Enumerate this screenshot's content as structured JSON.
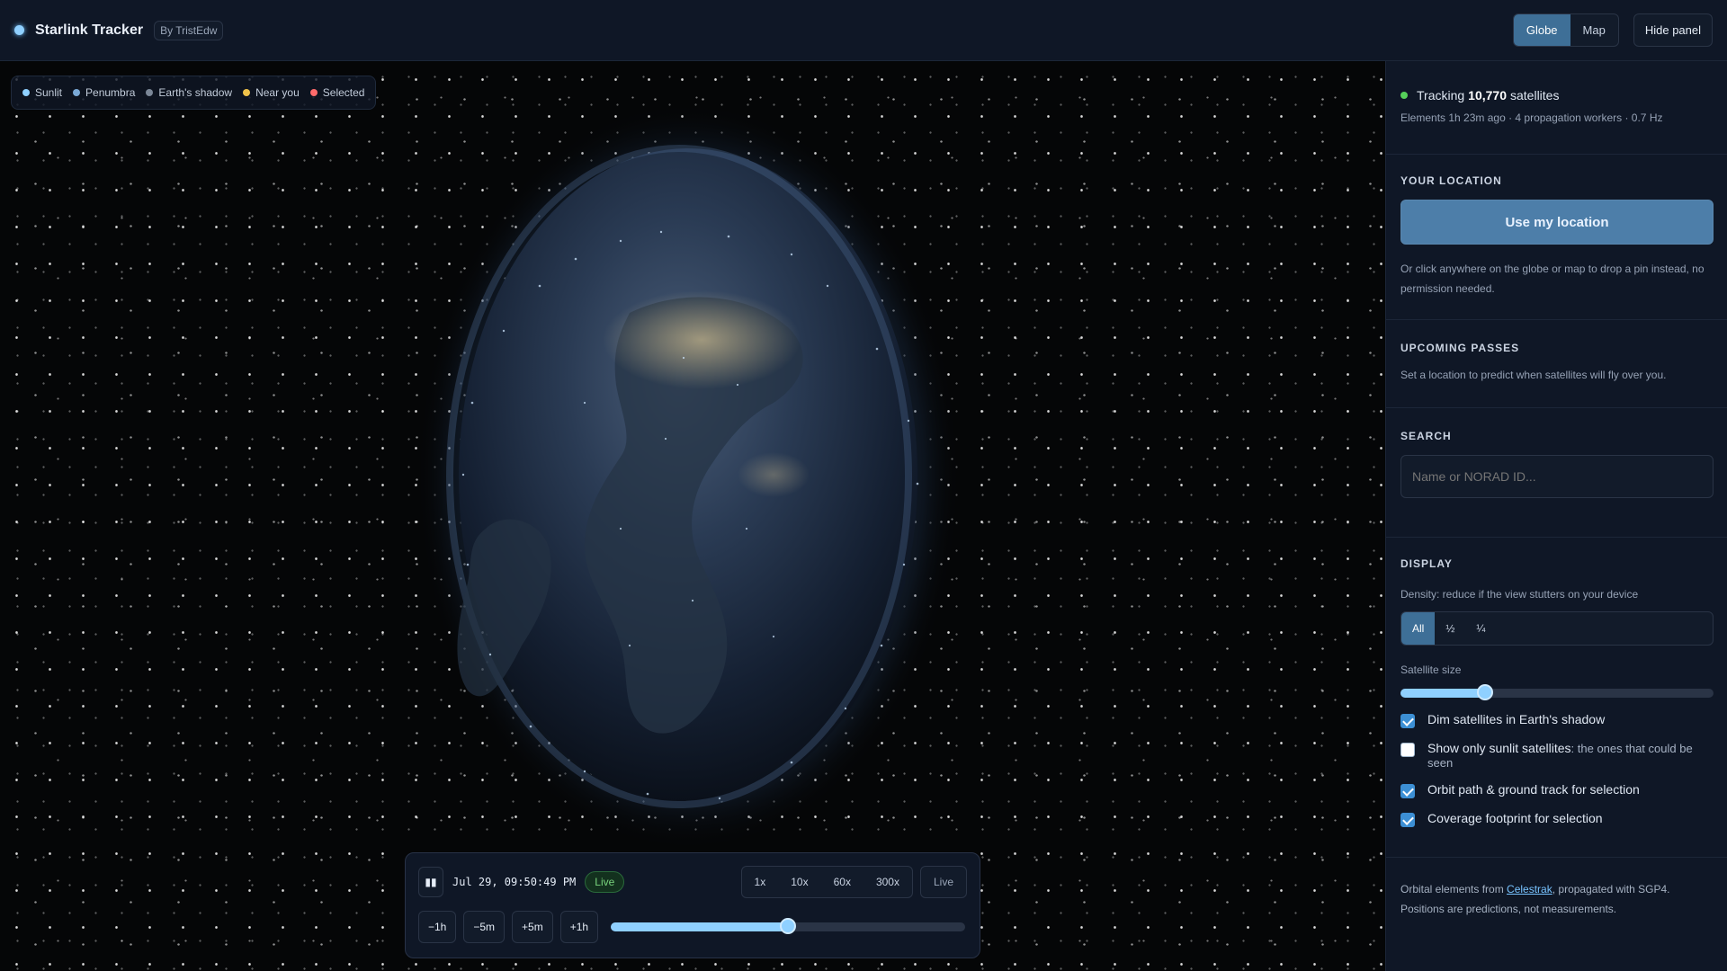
{
  "app": {
    "title": "Starlink Tracker",
    "by": "By TristEdw",
    "view_tabs": [
      {
        "label": "Globe",
        "active": true
      },
      {
        "label": "Map",
        "active": false
      }
    ],
    "hide_panel": "Hide panel"
  },
  "legend": [
    {
      "label": "Sunlit",
      "color": "#8fd0ff"
    },
    {
      "label": "Penumbra",
      "color": "#7aa9d6"
    },
    {
      "label": "Earth's shadow",
      "color": "#7b8797"
    },
    {
      "label": "Near you",
      "color": "#f0c24a"
    },
    {
      "label": "Selected",
      "color": "#ff6b6b"
    }
  ],
  "time": {
    "datetime": "Jul 29, 09:50:49 PM",
    "live_badge": "Live",
    "speeds": [
      "1x",
      "10x",
      "60x",
      "300x"
    ],
    "live_button": "Live",
    "jumps": [
      "−1h",
      "−5m",
      "+5m",
      "+1h"
    ],
    "slider_fraction": 0.5
  },
  "panel": {
    "status": {
      "prefix": "Tracking",
      "count": "10,770",
      "suffix": "satellites",
      "meta": "Elements 1h 23m ago · 4 propagation workers · 0.7 Hz"
    },
    "location": {
      "title": "YOUR LOCATION",
      "button": "Use my location",
      "hint": "Or click anywhere on the globe or map to drop a pin instead, no permission needed."
    },
    "passes": {
      "title": "UPCOMING PASSES",
      "text": "Set a location to predict when satellites will fly over you."
    },
    "search": {
      "title": "SEARCH",
      "placeholder": "Name or NORAD ID...",
      "value": ""
    },
    "display": {
      "title": "DISPLAY",
      "density_label": "Density: reduce if the view stutters on your device",
      "density_options": [
        {
          "label": "All",
          "active": true
        },
        {
          "label": "½",
          "active": false
        },
        {
          "label": "¼",
          "active": false
        }
      ],
      "size_label": "Satellite size",
      "size_fraction": 0.27,
      "checks": [
        {
          "label": "Dim satellites in Earth's shadow",
          "desc": "",
          "checked": true
        },
        {
          "label": "Show only sunlit satellites",
          "desc": ": the ones that could be seen",
          "checked": false
        },
        {
          "label": "Orbit path & ground track for selection",
          "desc": "",
          "checked": true
        },
        {
          "label": "Coverage footprint for selection",
          "desc": "",
          "checked": true
        }
      ]
    },
    "footer": {
      "prefix": "Orbital elements from",
      "link": "Celestrak",
      "suffix": ", propagated with SGP4.",
      "line2": "Positions are predictions, not measurements."
    }
  },
  "colors": {
    "accent": "#3e6f97",
    "sat_sunlit": "#8fd0ff",
    "live_green": "#78d37c"
  }
}
